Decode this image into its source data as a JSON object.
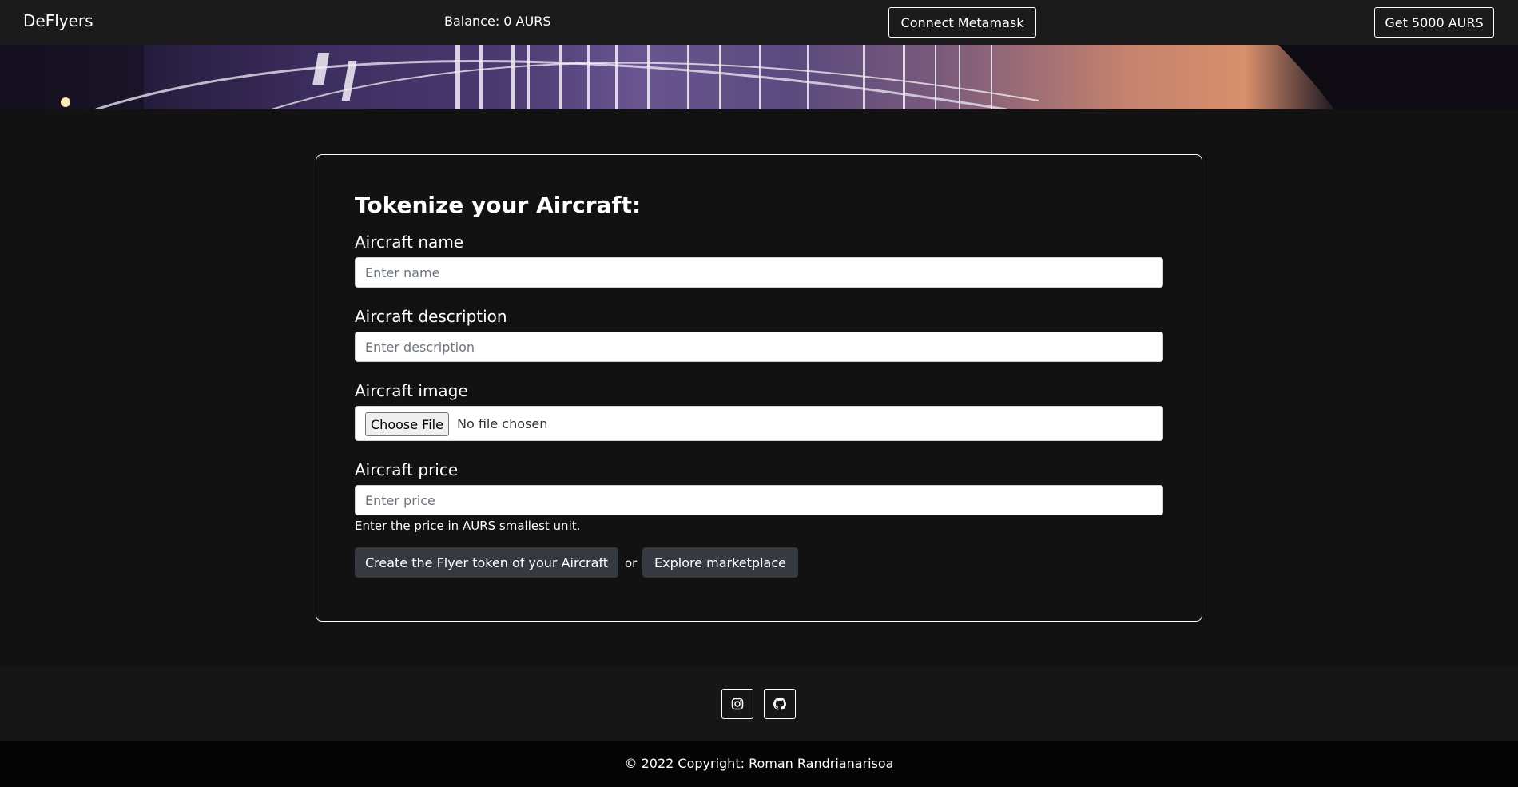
{
  "navbar": {
    "brand": "DeFlyers",
    "balance": "Balance: 0 AURS",
    "connect_label": "Connect Metamask",
    "get_label": "Get 5000 AURS"
  },
  "form": {
    "title": "Tokenize your Aircraft:",
    "name_label": "Aircraft name",
    "name_placeholder": "Enter name",
    "description_label": "Aircraft description",
    "description_placeholder": "Enter description",
    "image_label": "Aircraft image",
    "file_button": "Choose File",
    "file_status": "No file chosen",
    "price_label": "Aircraft price",
    "price_placeholder": "Enter price",
    "price_help": "Enter the price in AURS smallest unit.",
    "create_label": "Create the Flyer token of your Aircraft",
    "or_text": "or",
    "explore_label": "Explore marketplace"
  },
  "footer": {
    "social": [
      "instagram-icon",
      "github-icon"
    ],
    "copyright": "© 2022 Copyright: Roman Randrianarisoa"
  },
  "colors": {
    "background": "#121212",
    "navbar": "#1b1b1b",
    "button_dark": "#343a40",
    "footer": "#161616",
    "copyright_bar": "#050505"
  }
}
